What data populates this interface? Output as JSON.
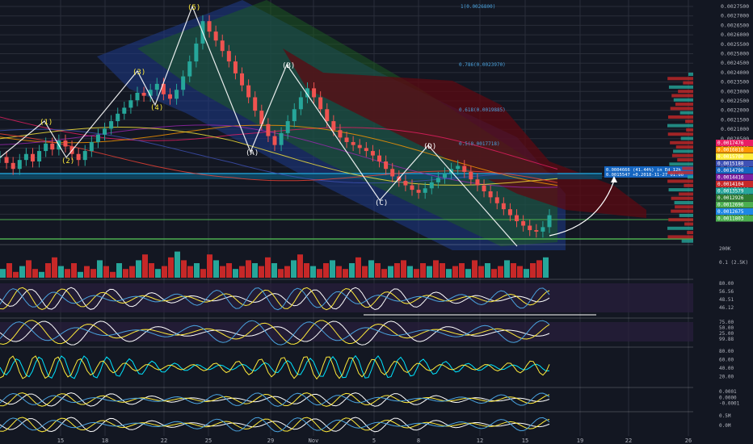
{
  "theme": {
    "background": "#131722",
    "grid": "#2a2e39",
    "up": "#ff4a68",
    "down": "#ff4a68",
    "candle_alt": "#26a69a",
    "axis_text": "#b2b5be",
    "wave_line": "#ffeb3b",
    "channel_blue": "#1e3a8a",
    "channel_green": "#1b5e20",
    "cloud_red": "#8b0000",
    "fib_text": "#4aa3df"
  },
  "chart_data": {
    "type": "candlestick",
    "price_axis": {
      "ticks": [
        "0.0027500",
        "0.0027000",
        "0.0026500",
        "0.0026000",
        "0.0025500",
        "0.0025000",
        "0.0024500",
        "0.0024000",
        "0.0023500",
        "0.0023000",
        "0.0022500",
        "0.0022000",
        "0.0021500",
        "0.0021000",
        "0.0020500",
        "0.0020000",
        "0.0019500",
        "0.0019000",
        "0.0018500",
        "0.0018000",
        "0.0017500",
        "0.0017000",
        "0.0012000"
      ],
      "ylim": [
        0.00118,
        0.00277
      ]
    },
    "time_axis": {
      "ticks": [
        "15",
        "18",
        "22",
        "25",
        "29",
        "Nov",
        "5",
        "8",
        "12",
        "15",
        "19",
        "22",
        "26"
      ]
    },
    "fib_levels": [
      {
        "label": "1(0.0026800)"
      },
      {
        "label": "0.786(0.0023970)"
      },
      {
        "label": "0.618(0.0019885)"
      },
      {
        "label": "0.5(0.0017718)"
      }
    ],
    "wave_labels": [
      "(1)",
      "(2)",
      "(3)",
      "(4)",
      "(5)",
      "(A)",
      "(B)",
      "(C)",
      "(D)"
    ],
    "projection_box": {
      "line1": "0.0004666 (41.44%) in Ed 12h",
      "line2": "0.0015547 +0.2018-11-27 01:00"
    },
    "price_tags": [
      "0.0017476",
      "0.0016818",
      "0.0015700",
      "0.0015188",
      "0.0014790",
      "0.0014416",
      "0.0014104",
      "0.0013579",
      "0.0012926",
      "0.0012696",
      "0.0012675",
      "0.0011803"
    ],
    "candles": [
      0.00174,
      0.0017,
      0.00166,
      0.00172,
      0.00176,
      0.00171,
      0.00178,
      0.00183,
      0.00179,
      0.00185,
      0.00181,
      0.00176,
      0.00172,
      0.00178,
      0.00184,
      0.00189,
      0.00193,
      0.00198,
      0.00203,
      0.00207,
      0.00212,
      0.00217,
      0.00215,
      0.00219,
      0.00223,
      0.00216,
      0.00213,
      0.00219,
      0.00228,
      0.00238,
      0.0025,
      0.00265,
      0.00258,
      0.00252,
      0.00245,
      0.00238,
      0.0023,
      0.00222,
      0.00214,
      0.00205,
      0.00196,
      0.00188,
      0.00182,
      0.0019,
      0.00198,
      0.00206,
      0.00214,
      0.0022,
      0.00214,
      0.00206,
      0.00198,
      0.00192,
      0.00187,
      0.00184,
      0.00182,
      0.0018,
      0.00178,
      0.00175,
      0.00171,
      0.00166,
      0.00161,
      0.00158,
      0.00155,
      0.00152,
      0.0015,
      0.00153,
      0.00157,
      0.0016,
      0.00163,
      0.00166,
      0.00168,
      0.00164,
      0.00159,
      0.00155,
      0.00151,
      0.00147,
      0.00143,
      0.00139,
      0.00135,
      0.00131,
      0.00128,
      0.00125,
      0.00124,
      0.00127,
      0.00135
    ]
  },
  "volume_panel": {
    "labels": [
      "200K",
      "0.1 (2.5K)"
    ],
    "bars": [
      3,
      5,
      2,
      4,
      6,
      3,
      2,
      5,
      7,
      4,
      3,
      5,
      2,
      4,
      3,
      6,
      4,
      2,
      5,
      3,
      4,
      6,
      8,
      5,
      3,
      4,
      7,
      9,
      6,
      4,
      5,
      3,
      8,
      6,
      4,
      5,
      3,
      4,
      6,
      5,
      4,
      7,
      5,
      3,
      4,
      6,
      8,
      5,
      4,
      3,
      5,
      6,
      4,
      3,
      5,
      7,
      4,
      6,
      5,
      3,
      4,
      5,
      6,
      4,
      3,
      5,
      4,
      6,
      5,
      3,
      4,
      5,
      3,
      6,
      4,
      5,
      3,
      4,
      6,
      5,
      4,
      3,
      5,
      6,
      7
    ]
  },
  "rsi_panel": {
    "labels": [
      "80.00",
      "56.56",
      "48.51",
      "46.12"
    ]
  },
  "stoch_panel": {
    "labels": [
      "75.00",
      "50.00",
      "25.00",
      "99.88"
    ]
  },
  "osc_panel": {
    "labels": [
      "80.00",
      "60.00",
      "40.00",
      "20.00"
    ]
  },
  "macd_panel": {
    "labels": [
      "0.0001",
      "0.0000",
      "-0.0001"
    ]
  },
  "last_panel": {
    "labels": [
      "0.5M",
      "0.0M"
    ]
  }
}
